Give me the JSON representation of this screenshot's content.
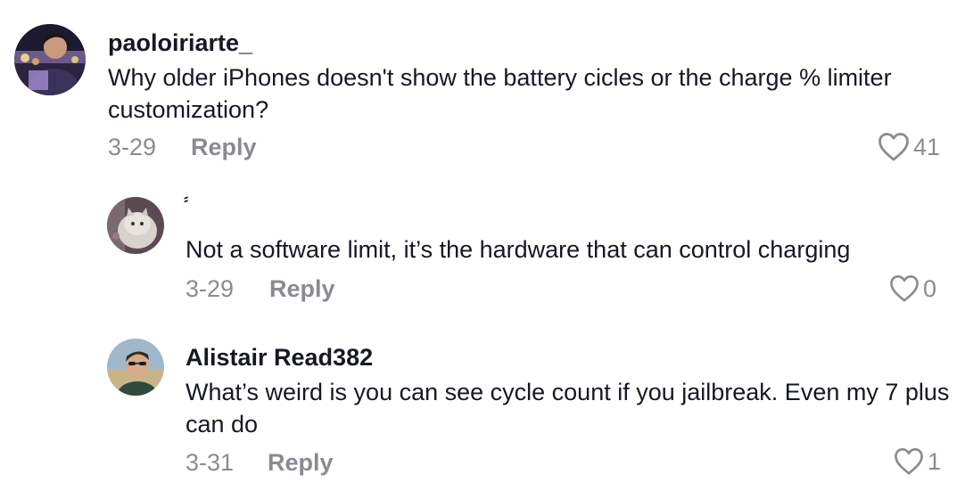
{
  "comments": [
    {
      "username": "paoloiriarte_",
      "text": "Why older iPhones doesn't show the battery cicles or the charge % limiter customization?",
      "date": "3-29",
      "reply_label": "Reply",
      "likes": "41",
      "avatar_icon": "user-avatar"
    },
    {
      "username": "⸗",
      "text": "Not a software limit, it’s the hardware that can control charging",
      "date": "3-29",
      "reply_label": "Reply",
      "likes": "0",
      "avatar_icon": "cat-avatar"
    },
    {
      "username": "Alistair Read382",
      "text": "What’s weird is you can see cycle count if you jailbreak. Even my 7 plus can do",
      "date": "3-31",
      "reply_label": "Reply",
      "likes": "1",
      "avatar_icon": "user-avatar"
    }
  ],
  "colors": {
    "text": "#161823",
    "muted": "#8a8b91"
  }
}
